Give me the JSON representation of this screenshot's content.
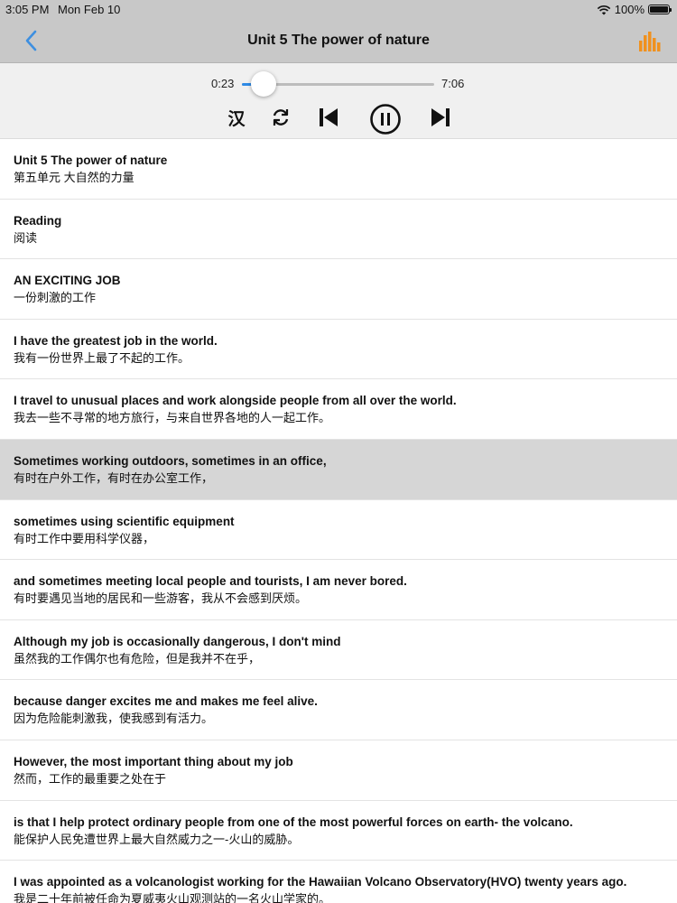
{
  "status_bar": {
    "time": "3:05 PM",
    "date": "Mon Feb 10",
    "battery": "100%"
  },
  "nav": {
    "title": "Unit 5 The power of nature",
    "back_icon": "chevron-left-icon",
    "stats_icon": "bar-chart-icon",
    "accent_color": "#f0911e",
    "back_color": "#3d8fe0"
  },
  "player": {
    "current_time": "0:23",
    "duration": "7:06",
    "progress_fraction": 0.054,
    "han_toggle_label": "汉",
    "accent_color": "#2e8ae6"
  },
  "sentences": [
    {
      "en": "Unit 5 The power of nature",
      "zh": "第五单元 大自然的力量",
      "selected": false
    },
    {
      "en": "Reading",
      "zh": "阅读",
      "selected": false
    },
    {
      "en": "AN EXCITING JOB",
      "zh": "一份刺激的工作",
      "selected": false
    },
    {
      "en": "I have the greatest job in the world.",
      "zh": "我有一份世界上最了不起的工作。",
      "selected": false
    },
    {
      "en": "I travel to unusual places and work alongside people from all over the world.",
      "zh": "我去一些不寻常的地方旅行，与来自世界各地的人一起工作。",
      "selected": false
    },
    {
      "en": "Sometimes working outdoors, sometimes in an office,",
      "zh": "有时在户外工作，有时在办公室工作，",
      "selected": true
    },
    {
      "en": "sometimes using scientific equipment",
      "zh": "有时工作中要用科学仪器，",
      "selected": false
    },
    {
      "en": "and sometimes meeting local people and tourists, I am never bored.",
      "zh": "有时要遇见当地的居民和一些游客，我从不会感到厌烦。",
      "selected": false
    },
    {
      "en": "Although my job is occasionally dangerous, I don't mind",
      "zh": "虽然我的工作偶尔也有危险，但是我并不在乎，",
      "selected": false
    },
    {
      "en": "because danger excites me and makes me feel alive.",
      "zh": "因为危险能刺激我，使我感到有活力。",
      "selected": false
    },
    {
      "en": "However, the most important thing about my job",
      "zh": "然而，工作的最重要之处在于",
      "selected": false
    },
    {
      "en": "is that I help protect ordinary people from one of the most powerful forces on earth- the volcano.",
      "zh": "能保护人民免遭世界上最大自然威力之一-火山的威胁。",
      "selected": false
    },
    {
      "en": "I was appointed as a volcanologist working for the Hawaiian Volcano Observatory(HVO) twenty years ago.",
      "zh": "我是二十年前被任命为夏威夷火山观测站的一名火山学家的。",
      "selected": false
    }
  ]
}
